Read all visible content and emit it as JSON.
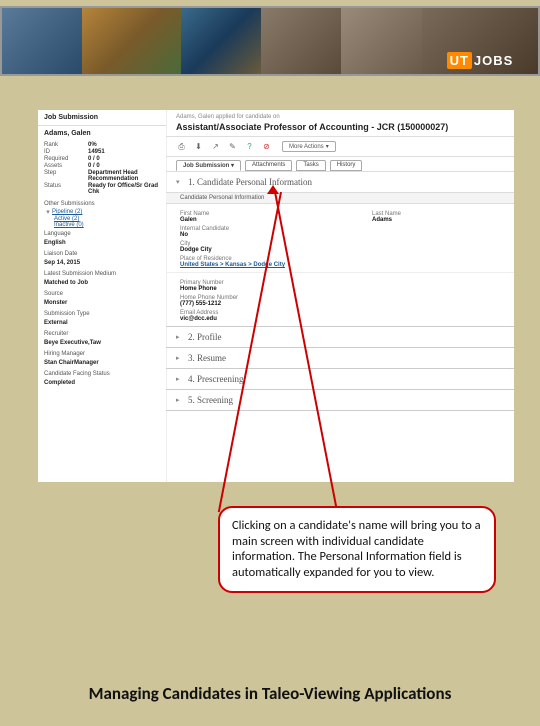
{
  "banner": {
    "logo_prefix": "UT",
    "logo_text": "JOBS"
  },
  "sidebar": {
    "panel_title": "Job Submission",
    "candidate_name": "Adams, Galen",
    "rows": [
      {
        "label": "Rank",
        "value": "0%"
      },
      {
        "label": "ID",
        "value": "14951"
      },
      {
        "label": "Required",
        "value": "0 / 0"
      },
      {
        "label": "Assets",
        "value": "0 / 0"
      },
      {
        "label": "Step",
        "value": "Department Head Recommendation"
      },
      {
        "label": "Status",
        "value": "Ready for Office/Sr Grad Chk"
      }
    ],
    "other_header": "Other Submissions",
    "pipeline": "Pipeline (2)",
    "active": "Active (2)",
    "inactive": "Inactive (0)",
    "lang_h": "Language",
    "lang_v": "English",
    "liaison_h": "Liaison Date",
    "liaison_v": "Sep 14, 2015",
    "medium_h": "Latest Submission Medium",
    "medium_v": "Matched to Job",
    "source_h": "Source",
    "source_v": "Monster",
    "subtype_h": "Submission Type",
    "subtype_v": "External",
    "recruiter_h": "Recruiter",
    "recruiter_v": "Beye Executive,Taw",
    "mgr_h": "Hiring Manager",
    "mgr_v": "Stan ChairManager",
    "cf_h": "Candidate Facing Status",
    "cf_v": "Completed"
  },
  "main": {
    "crumb": "Adams, Galen applied for candidate on",
    "position": "Assistant/Associate Professor of Accounting - JCR (150000027)",
    "more": "More Actions",
    "tabs": [
      "Job Submission",
      "Attachments",
      "Tasks",
      "History"
    ],
    "sec1_title": "1. Candidate Personal Information",
    "sec1_sub": "Candidate Personal Information",
    "first_l": "First Name",
    "first_v": "Galen",
    "last_l": "Last Name",
    "last_v": "Adams",
    "internal_l": "Internal Candidate",
    "internal_v": "No",
    "city_l": "City",
    "city_v": "Dodge City",
    "por_l": "Place of Residence",
    "por_v": "United States > Kansas > Dodge City",
    "pn_l": "Primary Number",
    "hp_l": "Home Phone",
    "hp_v": "Home Phone Number",
    "hp_val": "(777) 555-1212",
    "email_l": "Email Address",
    "email_v": "vic@dcc.edu",
    "sec2": "2. Profile",
    "sec3": "3. Resume",
    "sec4": "4. Prescreening",
    "sec5": "5. Screening"
  },
  "callout": "Clicking on a candidate's name will bring you to a main screen with individual candidate information. The Personal Information field is automatically expanded for you to view.",
  "footer": "Managing Candidates in Taleo-Viewing Applications"
}
